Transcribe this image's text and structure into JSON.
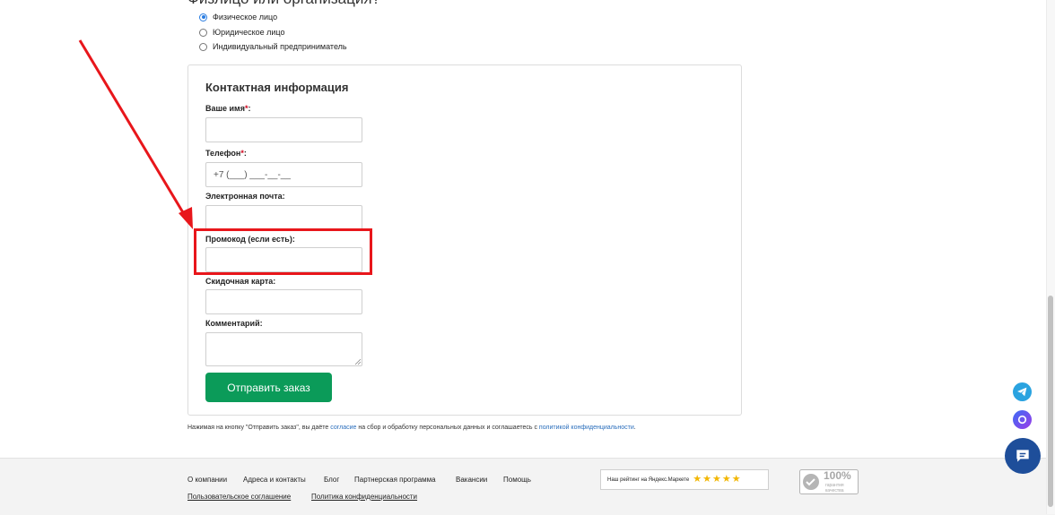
{
  "page": {
    "heading_partial": "Физлицо или организация?"
  },
  "customer_type": {
    "options": [
      {
        "label": "Физическое лицо",
        "selected": true
      },
      {
        "label": "Юридическое лицо",
        "selected": false
      },
      {
        "label": "Индивидуальный предприниматель",
        "selected": false
      }
    ]
  },
  "form": {
    "title": "Контактная информация",
    "required_mark": "*",
    "name_label": "Ваше имя",
    "phone_label": "Телефон",
    "phone_placeholder": "+7 (___) ___-__-__",
    "email_label": "Электронная почта:",
    "promo_label": "Промокод (если есть):",
    "discount_label": "Скидочная карта:",
    "comment_label": "Комментарий:",
    "submit_label": "Отправить заказ",
    "colon": ":"
  },
  "consent": {
    "text_before": "Нажимая на кнопку \"Отправить заказ\", вы даёте ",
    "consent_link": "согласие",
    "text_middle": " на сбор и обработку персональных данных и соглашаетесь с ",
    "policy_link": "политикой конфиденциальности",
    "text_after": "."
  },
  "footer": {
    "links": [
      "О компании",
      "Адреса и контакты",
      "Блог",
      "Партнерская программа",
      "Вакансии",
      "Помощь"
    ],
    "bottom_links": [
      "Пользовательское соглашение",
      "Политика конфиденциальности"
    ],
    "rating_text": "Наш рейтинг на Яндекс.Маркете",
    "rating_stars": 5,
    "guarantee_percent": "100%",
    "guarantee_line1": "гарантия",
    "guarantee_line2": "качества"
  },
  "colors": {
    "accent_green": "#0b9b59",
    "annotation_red": "#e8161b",
    "link_blue": "#2a6ebc",
    "telegram_blue": "#2aa3e0",
    "chat_blue": "#1e4e9a"
  },
  "icons": [
    "telegram-icon",
    "max-messenger-icon",
    "chat-icon",
    "star-icon",
    "guarantee-seal-icon"
  ]
}
